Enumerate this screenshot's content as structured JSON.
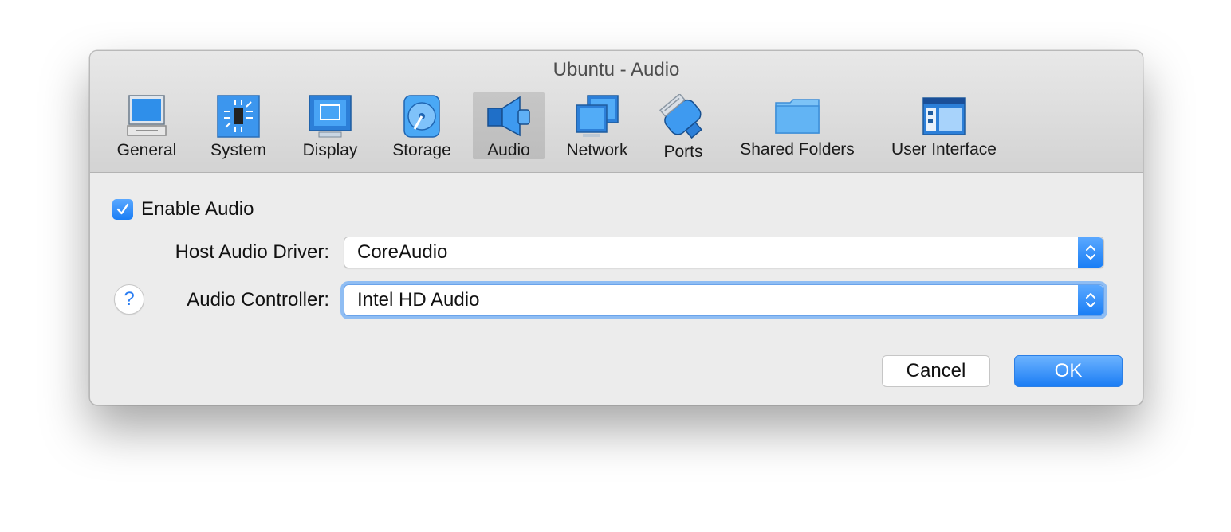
{
  "window": {
    "title": "Ubuntu - Audio"
  },
  "tabs": [
    {
      "label": "General",
      "icon": "general-monitor-icon"
    },
    {
      "label": "System",
      "icon": "chip-icon"
    },
    {
      "label": "Display",
      "icon": "display-icon"
    },
    {
      "label": "Storage",
      "icon": "disk-icon"
    },
    {
      "label": "Audio",
      "icon": "speaker-icon",
      "selected": true
    },
    {
      "label": "Network",
      "icon": "network-icon"
    },
    {
      "label": "Ports",
      "icon": "serial-port-icon"
    },
    {
      "label": "Shared Folders",
      "icon": "folder-icon"
    },
    {
      "label": "User Interface",
      "icon": "window-layout-icon"
    }
  ],
  "audio": {
    "enable_label": "Enable Audio",
    "enabled": true,
    "host_driver_label": "Host Audio Driver:",
    "host_driver_value": "CoreAudio",
    "controller_label": "Audio Controller:",
    "controller_value": "Intel HD Audio"
  },
  "footer": {
    "help_label": "?",
    "cancel_label": "Cancel",
    "ok_label": "OK"
  },
  "colors": {
    "accent": "#1a7ef5",
    "focus_ring": "#8fbdf3"
  }
}
